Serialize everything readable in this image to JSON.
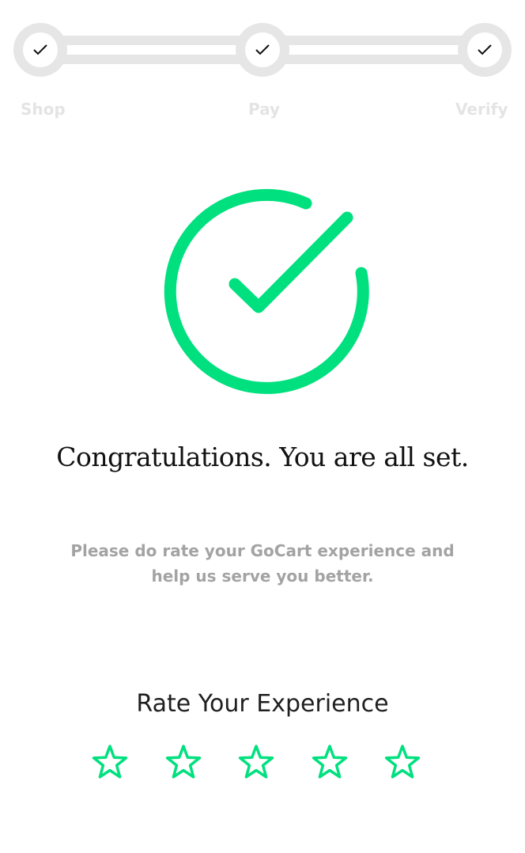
{
  "stepper": {
    "steps": [
      {
        "label": "Shop",
        "completed": true
      },
      {
        "label": "Pay",
        "completed": true
      },
      {
        "label": "Verify",
        "completed": true
      }
    ],
    "track_color": "#e6e6e6",
    "label_color": "#e4e4e4"
  },
  "success": {
    "icon": "check-circle-icon",
    "accent_color": "#00e07f"
  },
  "headline": "Congratulations. You are all set.",
  "subtext": "Please do rate your GoCart experience and help us serve you better.",
  "rating": {
    "title": "Rate Your Experience",
    "max_stars": 5,
    "current_rating": 0,
    "star_icon": "star-outline-icon",
    "star_color": "#00e07f"
  }
}
